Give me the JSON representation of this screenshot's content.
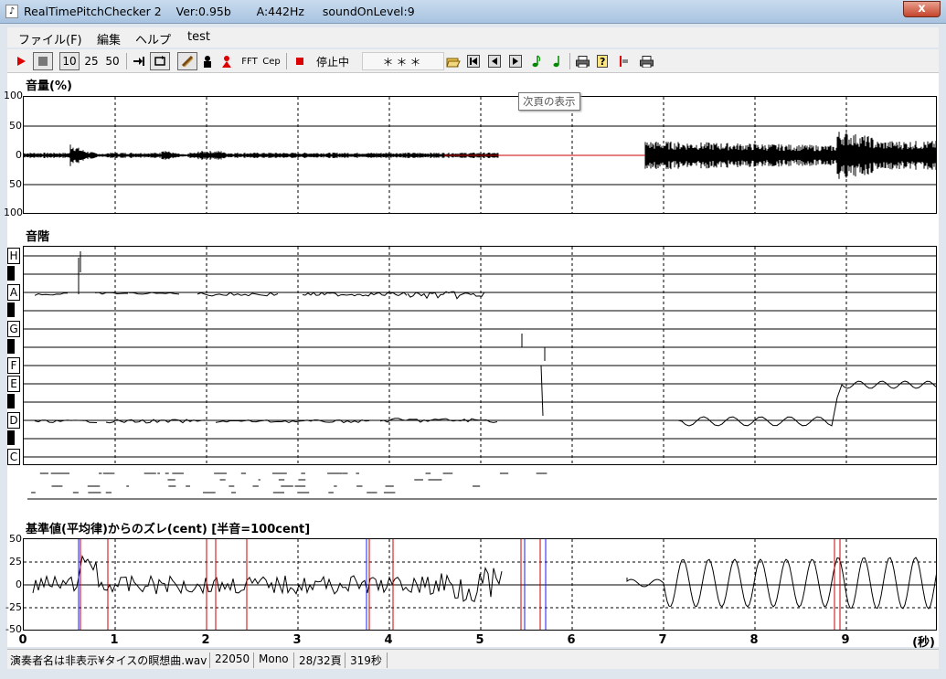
{
  "window": {
    "title": "RealTimePitchChecker 2    Ver:0.95b       A:442Hz     soundOnLevel:9",
    "close_glyph": "x"
  },
  "menu": [
    "ファイル(F)",
    "編集",
    "ヘルプ",
    "test"
  ],
  "toolbar": {
    "btn_10": "10",
    "btn_25": "25",
    "btn_50": "50",
    "fft": "FFT",
    "cep": "Cep",
    "status": "停止中",
    "note_display": "＊＊＊"
  },
  "tooltip": "次頁の表示",
  "volume_panel": {
    "title": "音量(%)",
    "y_ticks": [
      "100",
      "50",
      "0",
      "50",
      "100"
    ]
  },
  "scale_panel": {
    "title": "音階",
    "notes": [
      "H",
      "A",
      "G",
      "F",
      "E",
      "D",
      "C"
    ]
  },
  "cent_panel": {
    "title": "基準値(平均律)からのズレ(cent) [半音=100cent]",
    "y_ticks": [
      "50",
      "25",
      "0",
      "-25",
      "-50"
    ]
  },
  "time_axis": {
    "ticks": [
      "0",
      "1",
      "2",
      "3",
      "4",
      "5",
      "6",
      "7",
      "8",
      "9"
    ],
    "unit": "(秒)"
  },
  "statusbar": {
    "file": "演奏者名は非表示¥タイスの瞑想曲.wav",
    "rate": "22050",
    "channels": "Mono",
    "page": "28/32頁",
    "duration": "319秒"
  },
  "colors": {
    "accent_red": "#cc0000",
    "marker_blue": "#1a1aff"
  }
}
